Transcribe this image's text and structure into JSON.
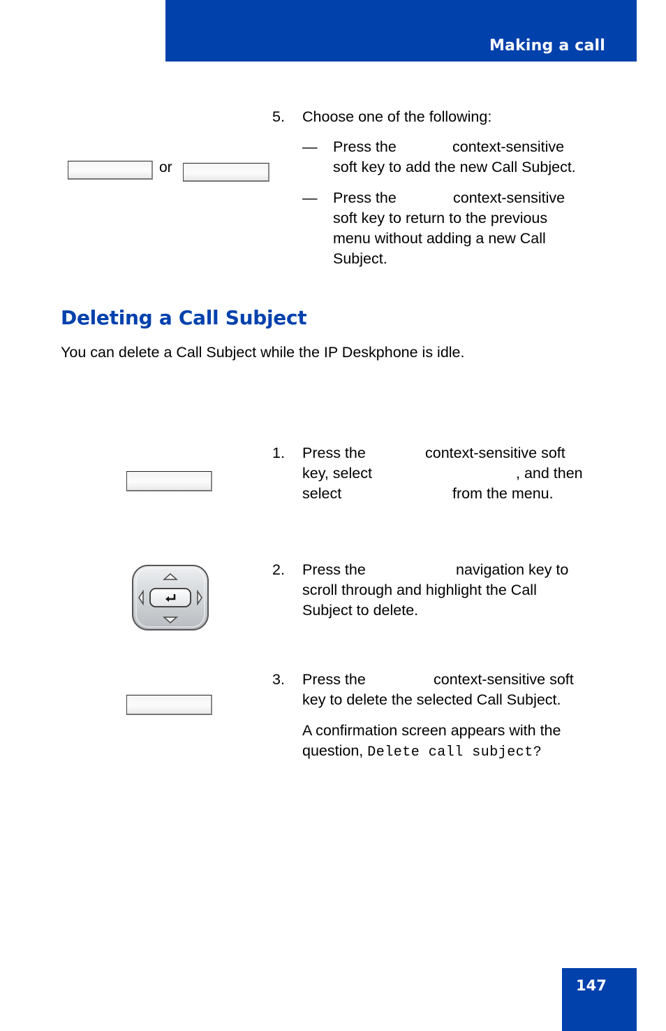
{
  "header": {
    "chapter_title": "Making a call"
  },
  "step5": {
    "number": "5.",
    "intro": "Choose one of the following:",
    "or_label": "or",
    "options": [
      {
        "dash": "—",
        "lines": [
          "Press the",
          "context-sensitive",
          "soft key to add the new Call Subject."
        ]
      },
      {
        "dash": "—",
        "lines": [
          "Press the",
          "context-sensitive",
          "soft key to return to the previous",
          "menu without adding a new Call",
          "Subject."
        ]
      }
    ]
  },
  "section": {
    "title": "Deleting a Call Subject",
    "intro": "You can delete a Call Subject while the IP Deskphone is idle."
  },
  "steps": [
    {
      "number": "1.",
      "lines": [
        "Press the",
        "context-sensitive soft",
        "key, select",
        ", and then",
        "select",
        "from the menu."
      ]
    },
    {
      "number": "2.",
      "lines": [
        "Press the",
        "navigation key to",
        "scroll through and highlight the Call",
        "Subject to delete."
      ]
    },
    {
      "number": "3.",
      "lines": [
        "Press the",
        "context-sensitive soft",
        "key to delete the selected Call Subject."
      ],
      "note_lines": [
        "A confirmation screen appears with the",
        "question,"
      ],
      "note_code": "Delete call subject?"
    }
  ],
  "icons": {
    "nav_key": "navigation-cluster-icon",
    "softkey": "soft-key-icon"
  },
  "footer": {
    "page_number": "147"
  },
  "colors": {
    "brand_blue": "#0041ac"
  }
}
